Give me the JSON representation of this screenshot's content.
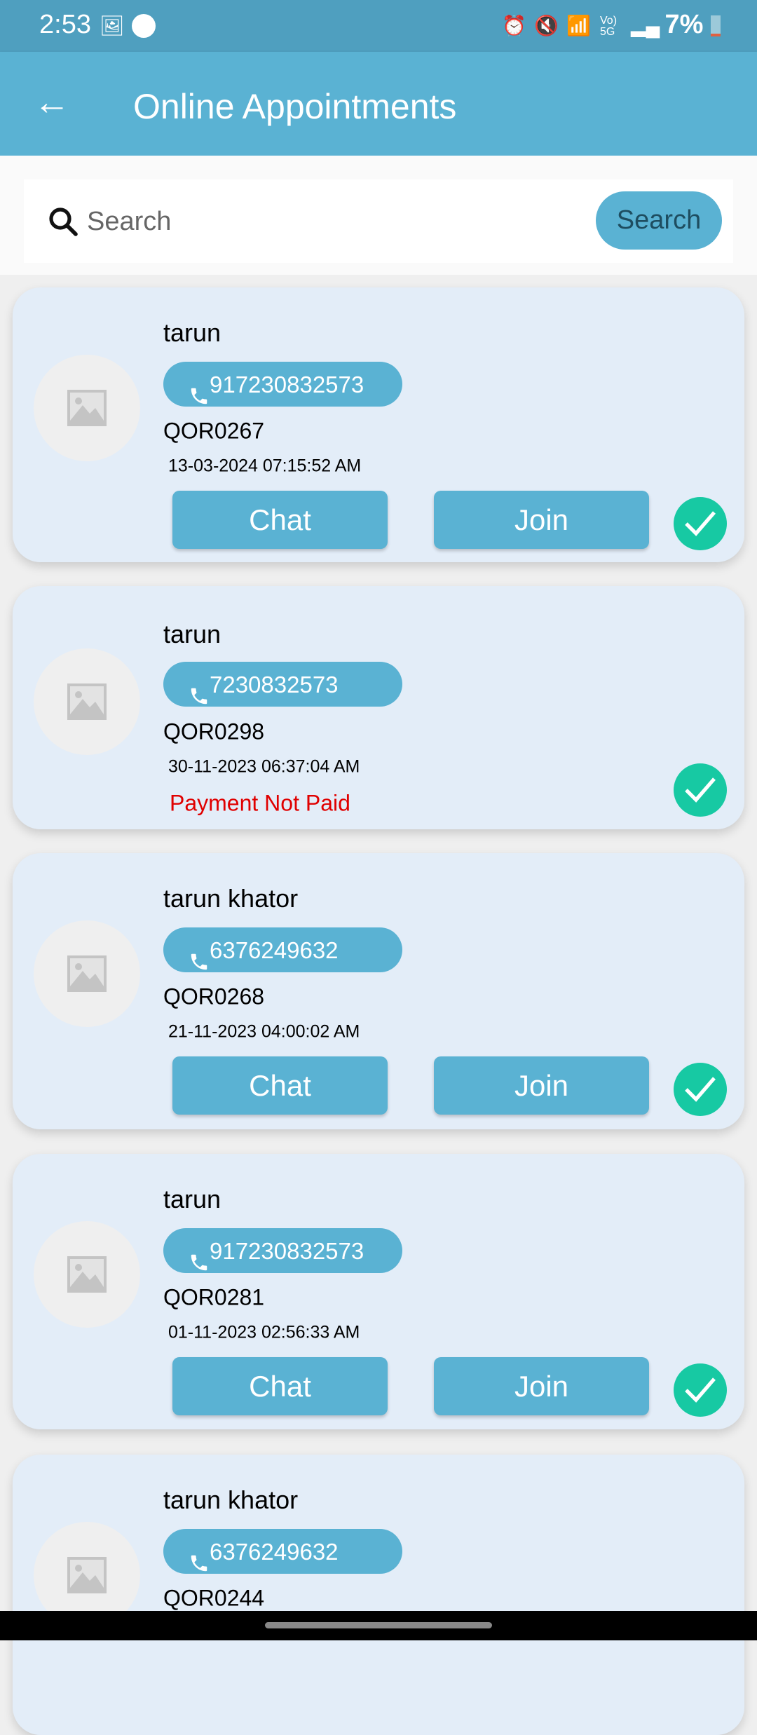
{
  "status_bar": {
    "time": "2:53",
    "battery": "7%",
    "icons": [
      "gallery-icon",
      "app-icon",
      "alarm-icon",
      "mute-icon",
      "wifi-icon",
      "volte-5g-icon",
      "signal-icon",
      "battery-icon"
    ]
  },
  "header": {
    "title": "Online Appointments",
    "back_icon": "arrow-left-icon"
  },
  "search": {
    "placeholder": "Search",
    "button_label": "Search"
  },
  "colors": {
    "primary": "#5ab2d3",
    "status_bar": "#4f9fbf",
    "card_bg": "#e3edf8",
    "check": "#17c9a3",
    "error": "#e00000"
  },
  "appointments": [
    {
      "name": "tarun",
      "phone": "917230832573",
      "code": "QOR0267",
      "datetime": "13-03-2024 07:15:52 AM",
      "chat_label": "Chat",
      "join_label": "Join",
      "payment_status": "",
      "completed": true
    },
    {
      "name": "tarun",
      "phone": "7230832573",
      "code": "QOR0298",
      "datetime": "30-11-2023 06:37:04 AM",
      "payment_status": "Payment Not Paid",
      "completed": true
    },
    {
      "name": "tarun khator",
      "phone": "6376249632",
      "code": "QOR0268",
      "datetime": "21-11-2023 04:00:02 AM",
      "chat_label": "Chat",
      "join_label": "Join",
      "payment_status": "",
      "completed": true
    },
    {
      "name": "tarun",
      "phone": "917230832573",
      "code": "QOR0281",
      "datetime": "01-11-2023 02:56:33 AM",
      "chat_label": "Chat",
      "join_label": "Join",
      "payment_status": "",
      "completed": true
    },
    {
      "name": "tarun khator",
      "phone": "6376249632",
      "code": "QOR0244"
    }
  ]
}
